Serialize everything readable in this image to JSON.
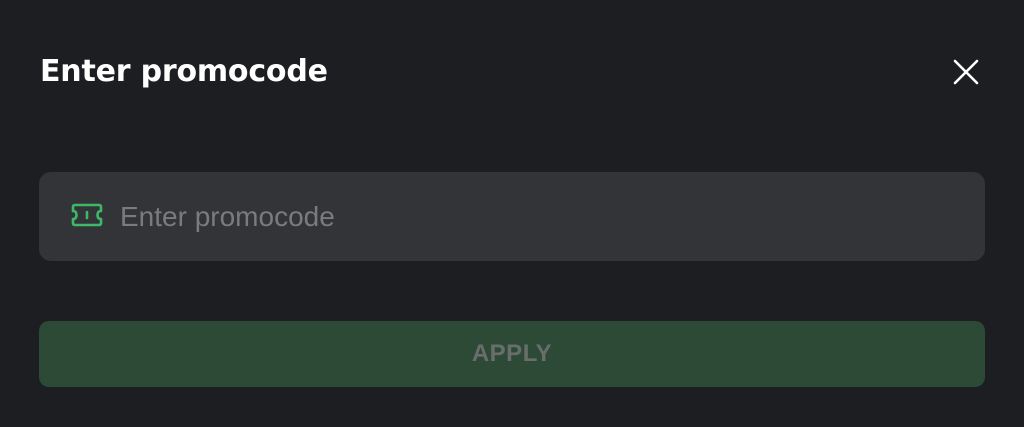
{
  "modal": {
    "title": "Enter promocode",
    "close_icon": "close-icon"
  },
  "promo_field": {
    "icon": "ticket-icon",
    "value": "",
    "placeholder": "Enter promocode"
  },
  "apply_button": {
    "label": "APPLY",
    "disabled": true
  },
  "colors": {
    "background": "#1d1e21",
    "field_background": "#333437",
    "accent_green": "#3fb768",
    "button_disabled_background": "#2d4a37",
    "button_disabled_text": "#696d6b",
    "placeholder_text": "#7a7b7e",
    "title_text": "#ffffff"
  }
}
